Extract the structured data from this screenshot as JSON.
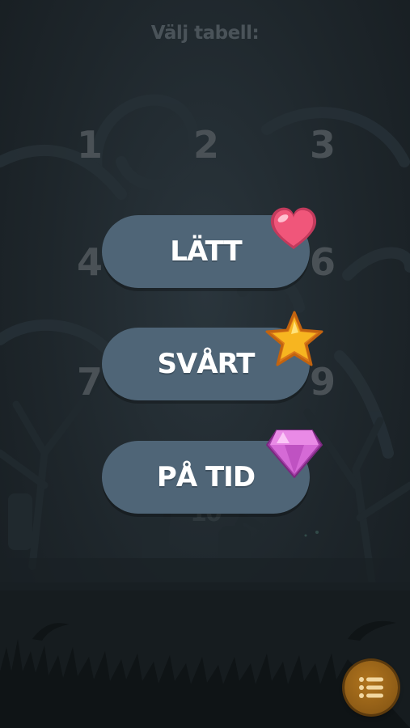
{
  "title": "Välj tabell:",
  "table_numbers": [
    "1",
    "2",
    "3",
    "4",
    "6",
    "7",
    "9",
    "10"
  ],
  "modes": [
    {
      "label": "LÄTT",
      "badge_icon": "heart-icon"
    },
    {
      "label": "SVÅRT",
      "badge_icon": "star-icon"
    },
    {
      "label": "PÅ TID",
      "badge_icon": "gem-icon"
    }
  ],
  "menu_button_icon": "list-icon",
  "colors": {
    "background": "#1c2328",
    "button": "#4f6577",
    "button_text": "#ffffff",
    "faded_text": "#4a5156",
    "heart": "#f0567a",
    "star": "#f7b520",
    "gem": "#d56ad6",
    "menu_button": "#9a6518"
  }
}
